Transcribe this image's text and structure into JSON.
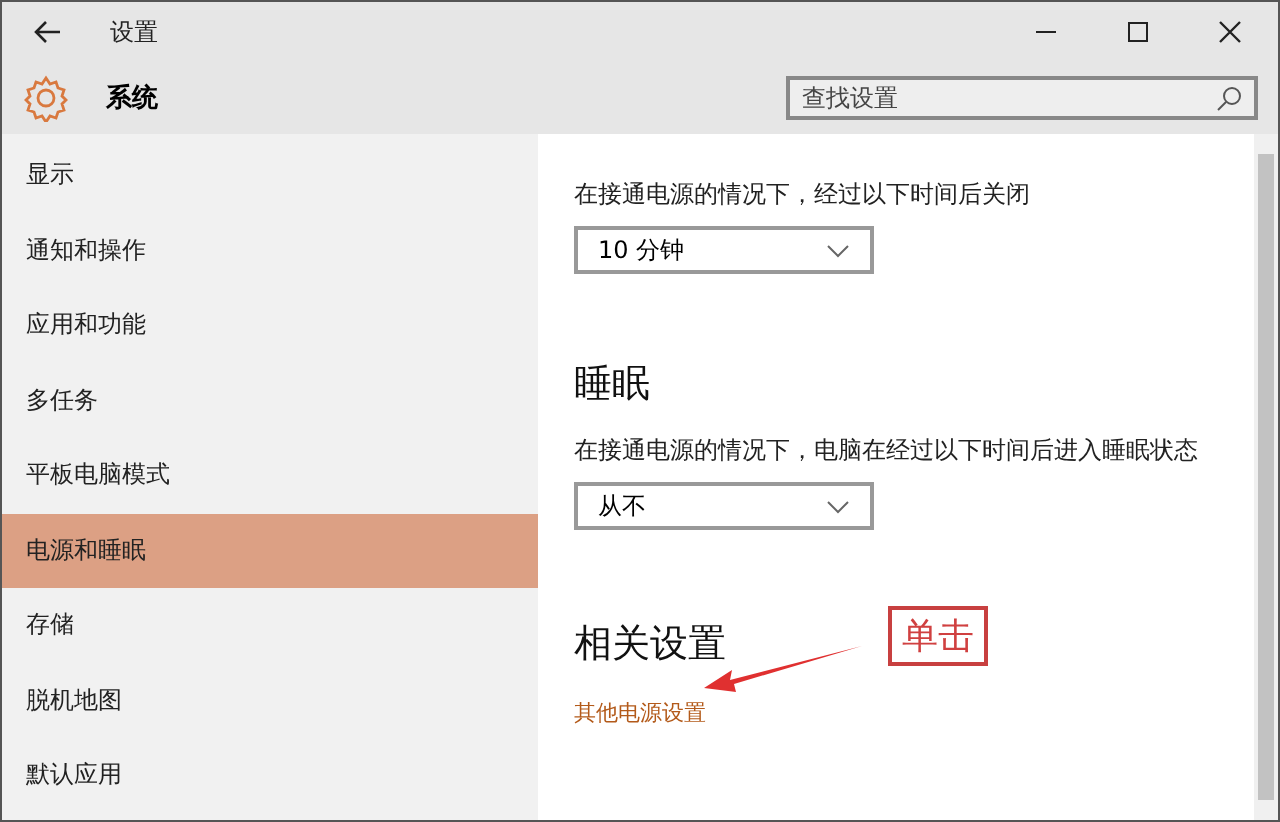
{
  "window": {
    "title": "设置"
  },
  "header": {
    "title": "系统",
    "search": {
      "placeholder": "查找设置"
    }
  },
  "sidebar": {
    "items": [
      {
        "label": "显示",
        "selected": false
      },
      {
        "label": "通知和操作",
        "selected": false
      },
      {
        "label": "应用和功能",
        "selected": false
      },
      {
        "label": "多任务",
        "selected": false
      },
      {
        "label": "平板电脑模式",
        "selected": false
      },
      {
        "label": "电源和睡眠",
        "selected": true
      },
      {
        "label": "存储",
        "selected": false
      },
      {
        "label": "脱机地图",
        "selected": false
      },
      {
        "label": "默认应用",
        "selected": false
      }
    ]
  },
  "content": {
    "screen": {
      "description": "在接通电源的情况下，经过以下时间后关闭",
      "value": "10 分钟"
    },
    "sleep": {
      "heading": "睡眠",
      "description": "在接通电源的情况下，电脑在经过以下时间后进入睡眠状态",
      "value": "从不"
    },
    "related": {
      "heading": "相关设置",
      "link": "其他电源设置"
    }
  },
  "annotation": {
    "label": "单击"
  }
}
